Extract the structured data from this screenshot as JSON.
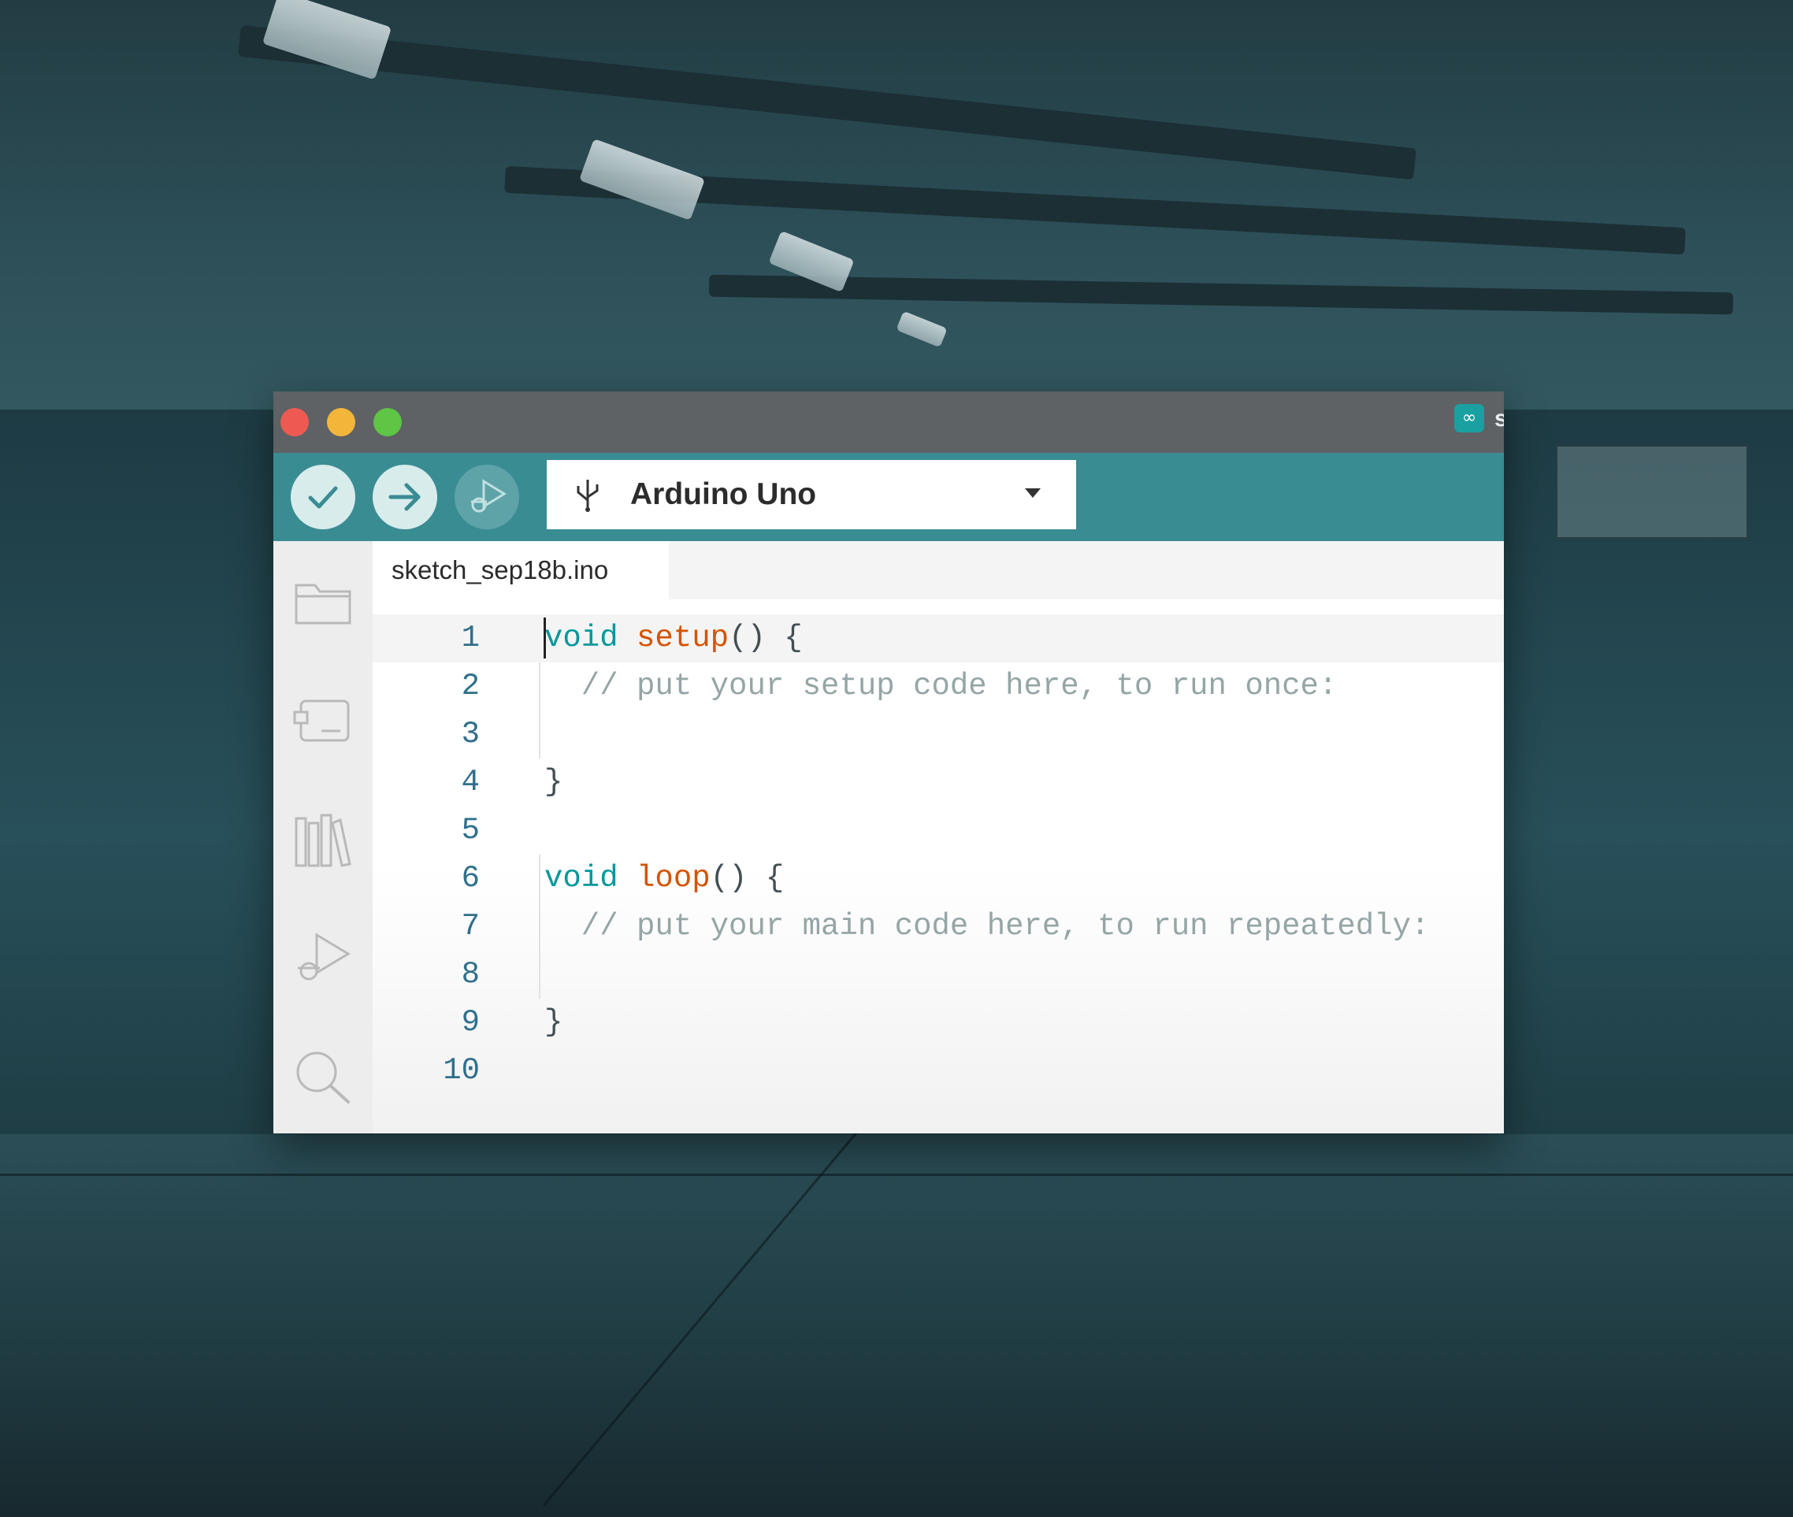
{
  "window": {
    "app_badge": "∞",
    "title_fragment": "s"
  },
  "toolbar": {
    "verify_icon": "check-icon",
    "upload_icon": "arrow-right-icon",
    "debug_icon": "debug-icon",
    "board_name": "Arduino Uno",
    "board_icon": "usb-icon"
  },
  "sidebar": {
    "items": [
      {
        "icon": "folder-icon"
      },
      {
        "icon": "board-manager-icon"
      },
      {
        "icon": "library-icon"
      },
      {
        "icon": "debug-icon"
      },
      {
        "icon": "search-icon"
      }
    ]
  },
  "editor": {
    "tab_label": "sketch_sep18b.ino",
    "lines": [
      {
        "n": "1",
        "parts": [
          [
            "kw",
            "void"
          ],
          [
            "tx",
            " "
          ],
          [
            "fn",
            "setup"
          ],
          [
            "tx",
            "() {"
          ]
        ]
      },
      {
        "n": "2",
        "parts": [
          [
            "cm",
            "  // put your setup code here, to run once:"
          ]
        ]
      },
      {
        "n": "3",
        "parts": []
      },
      {
        "n": "4",
        "parts": [
          [
            "tx",
            "}"
          ]
        ]
      },
      {
        "n": "5",
        "parts": []
      },
      {
        "n": "6",
        "parts": [
          [
            "kw",
            "void"
          ],
          [
            "tx",
            " "
          ],
          [
            "fn",
            "loop"
          ],
          [
            "tx",
            "() {"
          ]
        ]
      },
      {
        "n": "7",
        "parts": [
          [
            "cm",
            "  // put your main code here, to run repeatedly:"
          ]
        ]
      },
      {
        "n": "8",
        "parts": []
      },
      {
        "n": "9",
        "parts": [
          [
            "tx",
            "}"
          ]
        ]
      },
      {
        "n": "10",
        "parts": []
      }
    ]
  },
  "colors": {
    "toolbar": "#3a8c93",
    "keyword": "#00979c",
    "function": "#d35400",
    "comment": "#95a5a6",
    "line_number": "#2f6f8c"
  }
}
